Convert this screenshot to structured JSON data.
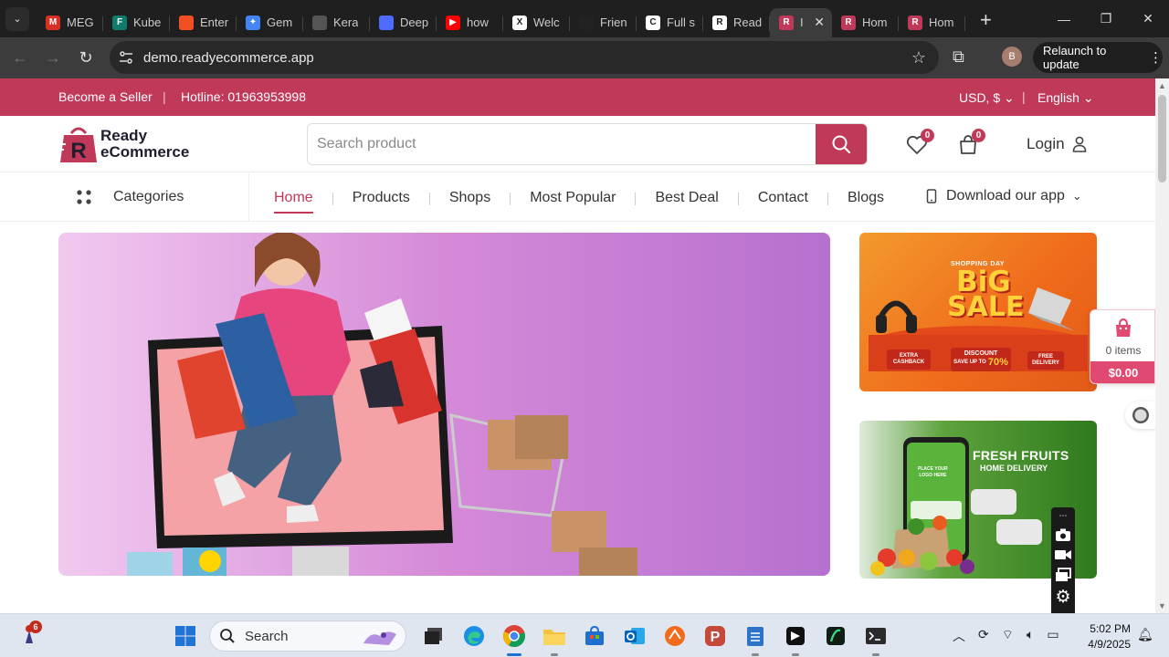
{
  "browser": {
    "tabs": [
      {
        "title": "MEG",
        "fav_color": "#d93025",
        "fav_letter": "M"
      },
      {
        "title": "Kube",
        "fav_color": "#0f7b6c",
        "fav_letter": "F"
      },
      {
        "title": "Enter",
        "fav_color": "#f25022",
        "fav_letter": ""
      },
      {
        "title": "Gem",
        "fav_color": "#4285f4",
        "fav_letter": "✦"
      },
      {
        "title": "Kera",
        "fav_color": "#555555",
        "fav_letter": ""
      },
      {
        "title": "Deep",
        "fav_color": "#4d6bfe",
        "fav_letter": ""
      },
      {
        "title": "how",
        "fav_color": "#ff0000",
        "fav_letter": "▶"
      },
      {
        "title": "Welc",
        "fav_color": "#ffffff",
        "fav_letter": "X"
      },
      {
        "title": "Frien",
        "fav_color": "#222222",
        "fav_letter": ""
      },
      {
        "title": "Full s",
        "fav_color": "#ffffff",
        "fav_letter": "C"
      },
      {
        "title": "Read",
        "fav_color": "#ffffff",
        "fav_letter": "R"
      },
      {
        "title": "I",
        "fav_color": "#c13959",
        "fav_letter": "R",
        "active": true
      },
      {
        "title": "Hom",
        "fav_color": "#c13959",
        "fav_letter": "R"
      },
      {
        "title": "Hom",
        "fav_color": "#c13959",
        "fav_letter": "R"
      }
    ],
    "url": "demo.readyecommerce.app",
    "profile_initial": "B",
    "relaunch_label": "Relaunch to update"
  },
  "topbar": {
    "seller_link": "Become a Seller",
    "hotline": "Hotline: 01963953998",
    "currency": "USD, $",
    "language": "English"
  },
  "header": {
    "logo_line1": "Ready",
    "logo_line2": "eCommerce",
    "search_placeholder": "Search product",
    "wishlist_count": "0",
    "cart_count": "0",
    "login_label": "Login"
  },
  "nav": {
    "categories_label": "Categories",
    "items": [
      "Home",
      "Products",
      "Shops",
      "Most Popular",
      "Best Deal",
      "Contact",
      "Blogs"
    ],
    "active_item": "Home",
    "download_label": "Download our app"
  },
  "promos": {
    "promo1_small": "SHOPPING DAY",
    "promo1_big1": "BiG",
    "promo1_big2": "SALE",
    "promo1_tag1": "EXTRA CASHBACK",
    "promo1_tag2": "DISCOUNT",
    "promo1_tag2b": "SAVE UP TO",
    "promo1_tag2c": "70%",
    "promo1_tag3": "FREE DELIVERY",
    "promo2_title1": "FRESH FRUITS",
    "promo2_title2": "HOME DELIVERY",
    "promo2_phone1": "PLACE YOUR",
    "promo2_phone2": "LOGO HERE"
  },
  "cart_widget": {
    "items_label": "0 items",
    "total": "$0.00"
  },
  "taskbar": {
    "weather_badge": "6",
    "search_label": "Search",
    "time": "5:02 PM",
    "date": "4/9/2025"
  },
  "colors": {
    "brand": "#c13959",
    "cart_total_bg": "#e04a70"
  }
}
